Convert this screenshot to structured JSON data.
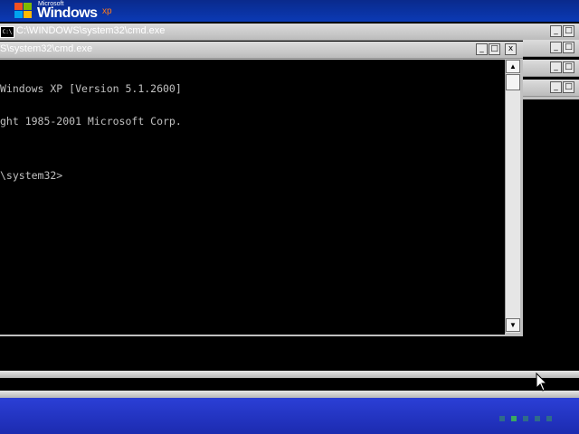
{
  "logo": {
    "microsoft": "Microsoft",
    "windows": "Windows",
    "xp": "xp"
  },
  "windows": {
    "back": {
      "title": "C:\\WINDOWS\\system32\\cmd.exe"
    },
    "front": {
      "title": "S\\system32\\cmd.exe",
      "console_lines": [
        "Windows XP [Version 5.1.2600]",
        "ght 1985-2001 Microsoft Corp.",
        "",
        "\\system32>"
      ]
    }
  },
  "controls": {
    "minimize": "_",
    "maximize": "□",
    "close": "x"
  },
  "scrollbar": {
    "up": "▲",
    "down": "▼"
  },
  "cmd_icon": "C:\\",
  "colors": {
    "taskbar": "#1c2bb0",
    "console_text": "#c0c0c0",
    "dot_active": "#3aa860",
    "dot_inactive": "#2f6b8a"
  }
}
